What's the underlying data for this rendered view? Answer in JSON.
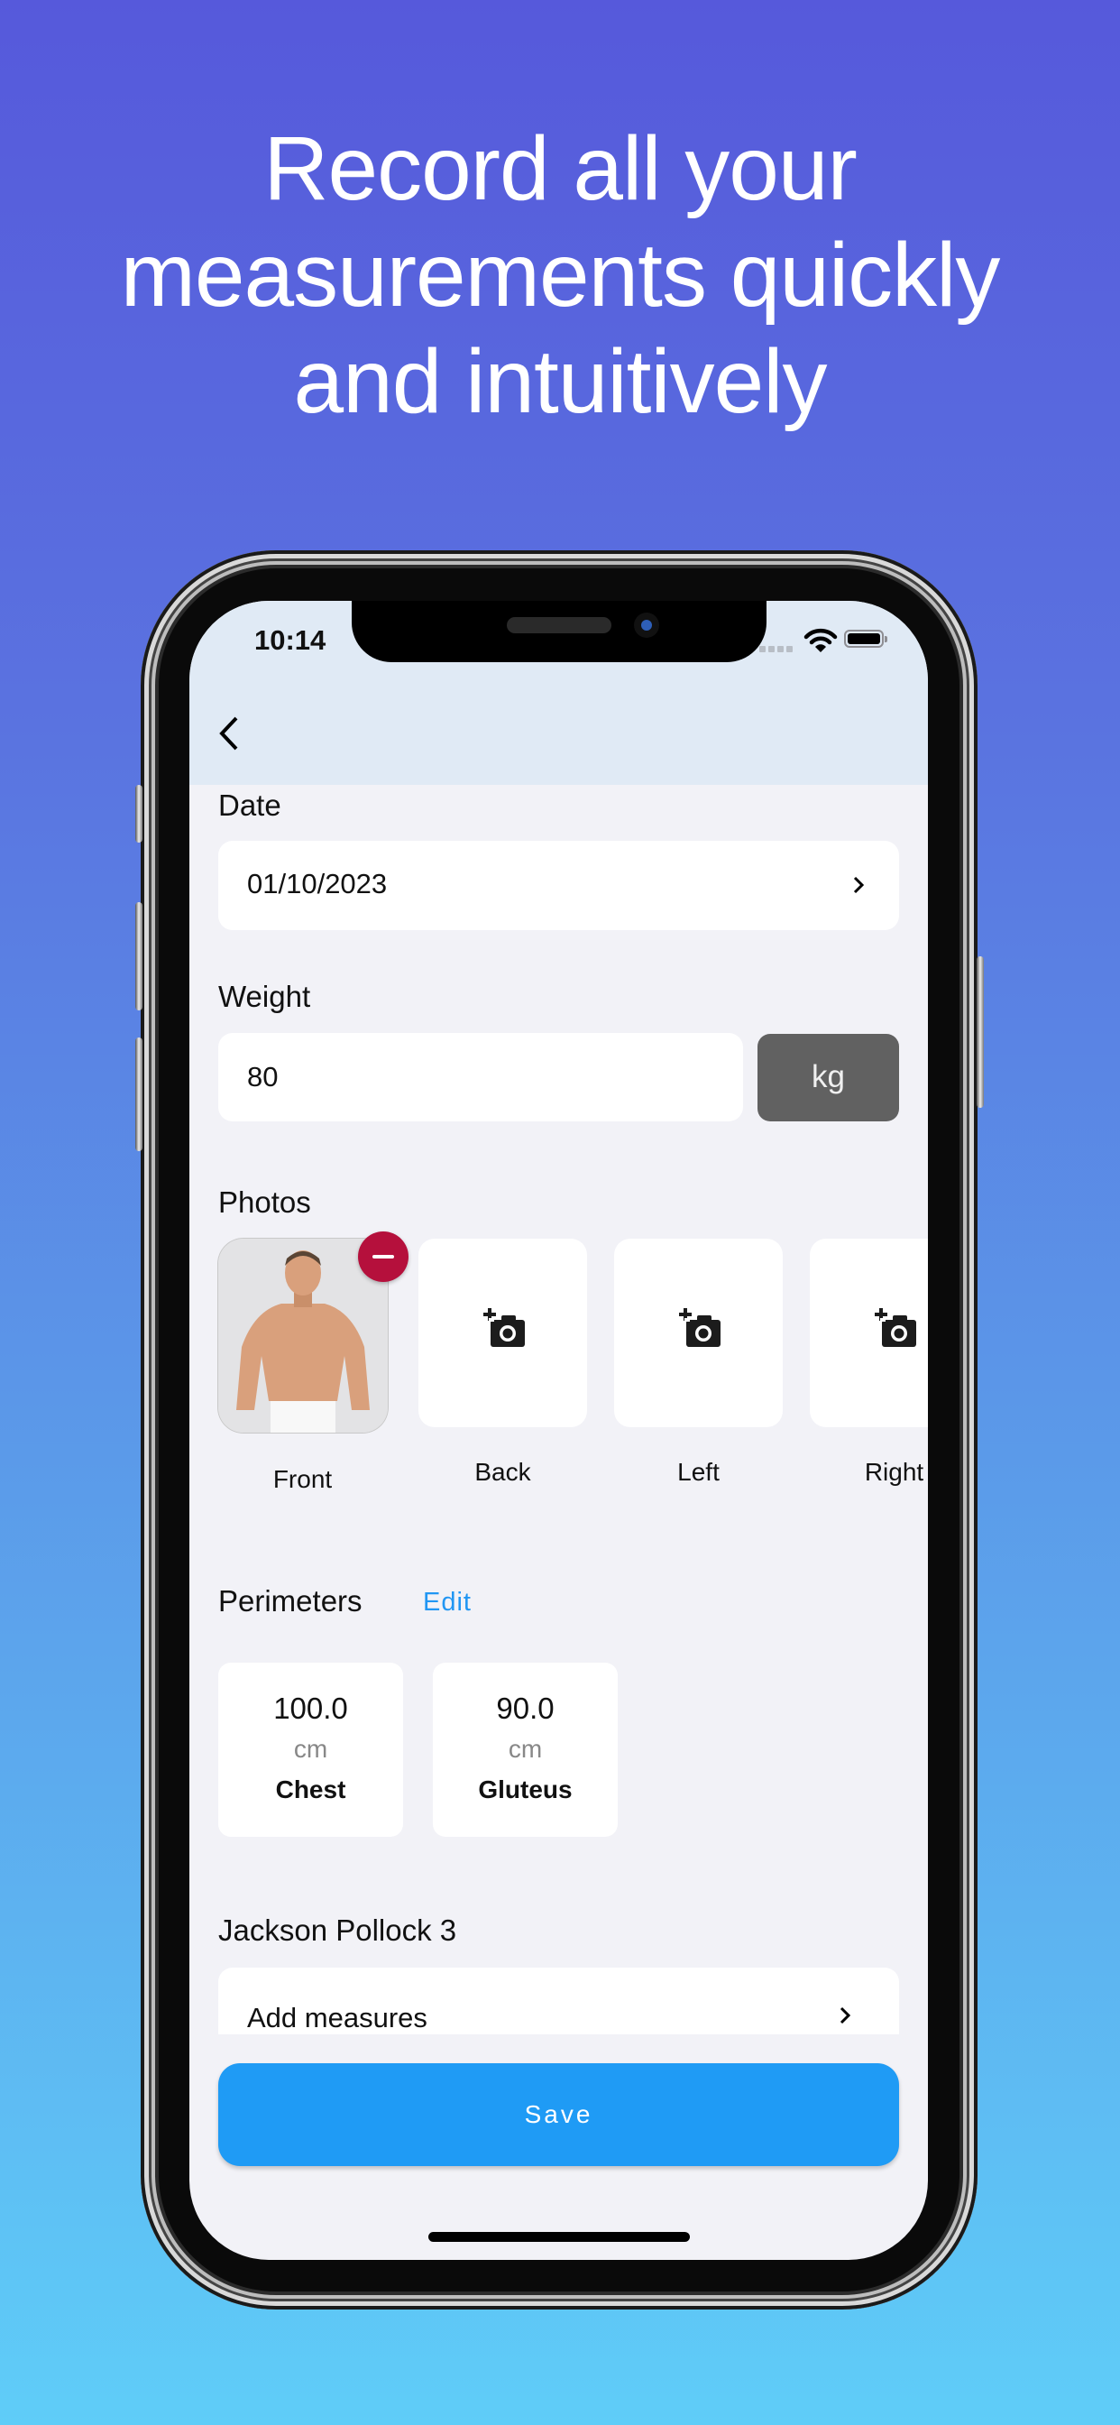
{
  "promo": {
    "headline_lines": [
      "Record all your",
      "measurements quickly",
      "and intuitively"
    ]
  },
  "status_bar": {
    "time": "10:14",
    "icons": [
      "cellular-signal-icon",
      "wifi-icon",
      "battery-icon"
    ]
  },
  "nav": {
    "back_icon": "chevron-left-icon"
  },
  "form": {
    "date": {
      "label": "Date",
      "value": "01/10/2023",
      "icon": "chevron-right-icon"
    },
    "weight": {
      "label": "Weight",
      "value": "80",
      "unit": "kg"
    },
    "photos": {
      "label": "Photos",
      "items": [
        {
          "label": "Front",
          "has_photo": true,
          "remove_icon": "minus-circle-icon"
        },
        {
          "label": "Back",
          "has_photo": false,
          "icon": "add-photo-icon"
        },
        {
          "label": "Left",
          "has_photo": false,
          "icon": "add-photo-icon"
        },
        {
          "label": "Right",
          "has_photo": false,
          "icon": "add-photo-icon"
        }
      ]
    },
    "perimeters": {
      "label": "Perimeters",
      "edit_label": "Edit",
      "items": [
        {
          "value": "100.0",
          "unit": "cm",
          "name": "Chest"
        },
        {
          "value": "90.0",
          "unit": "cm",
          "name": "Gluteus"
        }
      ]
    },
    "body_fat": {
      "label": "Jackson Pollock 3",
      "add_label": "Add measures",
      "icon": "chevron-right-icon"
    },
    "save_label": "Save"
  },
  "colors": {
    "accent": "#1f9bf5",
    "edit_link": "#2196f3",
    "remove_badge": "#b5103c",
    "unit_button": "#616161",
    "header_bg": "#e0eaf5",
    "content_bg": "#f2f2f7"
  }
}
